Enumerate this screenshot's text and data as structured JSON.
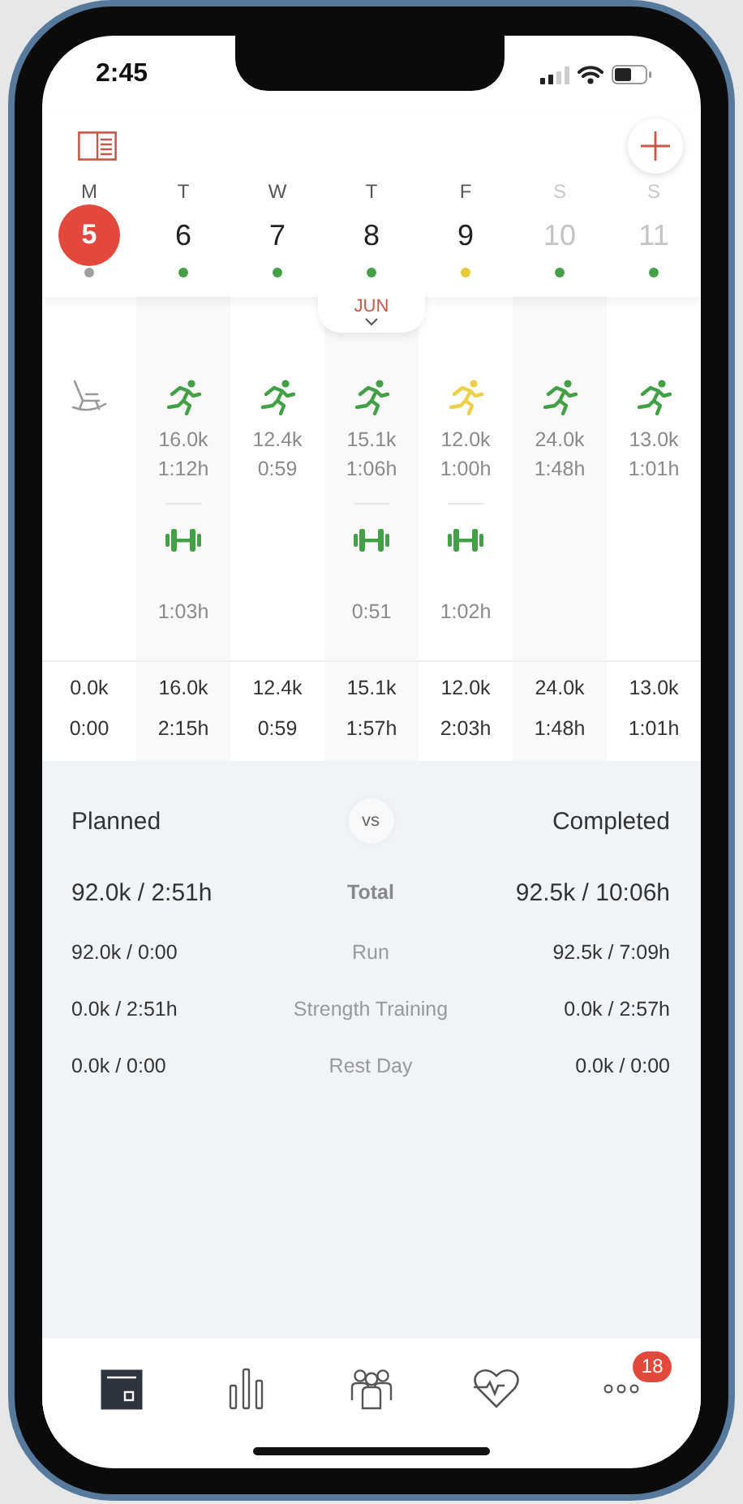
{
  "status_bar": {
    "time": "2:45"
  },
  "week": {
    "month": "JUN",
    "days": [
      {
        "weekday": "M",
        "date": "5",
        "selected": true,
        "muted": false,
        "color": "#a0a0a0",
        "activities": [
          {
            "kind": "rest"
          }
        ],
        "total_distance": "0.0k",
        "total_time": "0:00"
      },
      {
        "weekday": "T",
        "date": "6",
        "selected": false,
        "muted": false,
        "color": "#43a047",
        "activities": [
          {
            "kind": "run",
            "color": "#43a047",
            "distance": "16.0k",
            "duration": "1:12h"
          },
          {
            "kind": "strength",
            "color": "#43a047",
            "duration": "1:03h"
          }
        ],
        "total_distance": "16.0k",
        "total_time": "2:15h"
      },
      {
        "weekday": "W",
        "date": "7",
        "selected": false,
        "muted": false,
        "color": "#43a047",
        "activities": [
          {
            "kind": "run",
            "color": "#43a047",
            "distance": "12.4k",
            "duration": "0:59"
          }
        ],
        "total_distance": "12.4k",
        "total_time": "0:59"
      },
      {
        "weekday": "T",
        "date": "8",
        "selected": false,
        "muted": false,
        "color": "#43a047",
        "activities": [
          {
            "kind": "run",
            "color": "#43a047",
            "distance": "15.1k",
            "duration": "1:06h"
          },
          {
            "kind": "strength",
            "color": "#43a047",
            "duration": "0:51"
          }
        ],
        "total_distance": "15.1k",
        "total_time": "1:57h"
      },
      {
        "weekday": "F",
        "date": "9",
        "selected": false,
        "muted": false,
        "color": "#e8c93a",
        "activities": [
          {
            "kind": "run",
            "color": "#ecd04a",
            "distance": "12.0k",
            "duration": "1:00h"
          },
          {
            "kind": "strength",
            "color": "#43a047",
            "duration": "1:02h"
          }
        ],
        "total_distance": "12.0k",
        "total_time": "2:03h"
      },
      {
        "weekday": "S",
        "date": "10",
        "selected": false,
        "muted": true,
        "color": "#43a047",
        "activities": [
          {
            "kind": "run",
            "color": "#43a047",
            "distance": "24.0k",
            "duration": "1:48h"
          }
        ],
        "total_distance": "24.0k",
        "total_time": "1:48h"
      },
      {
        "weekday": "S",
        "date": "11",
        "selected": false,
        "muted": true,
        "color": "#43a047",
        "activities": [
          {
            "kind": "run",
            "color": "#43a047",
            "distance": "13.0k",
            "duration": "1:01h"
          }
        ],
        "total_distance": "13.0k",
        "total_time": "1:01h"
      }
    ]
  },
  "summary": {
    "planned_label": "Planned",
    "vs": "vs",
    "completed_label": "Completed",
    "rows": [
      {
        "kind": "total",
        "label": "Total",
        "planned": "92.0k / 2:51h",
        "completed": "92.5k / 10:06h"
      },
      {
        "kind": "item",
        "label": "Run",
        "planned": "92.0k / 0:00",
        "completed": "92.5k / 7:09h"
      },
      {
        "kind": "item",
        "label": "Strength Training",
        "planned": "0.0k / 2:51h",
        "completed": "0.0k / 2:57h"
      },
      {
        "kind": "item",
        "label": "Rest Day",
        "planned": "0.0k / 0:00",
        "completed": "0.0k / 0:00"
      }
    ]
  },
  "tab_bar": [
    {
      "kind": "calendar",
      "selected": true
    },
    {
      "kind": "stats",
      "selected": false
    },
    {
      "kind": "groups",
      "selected": false
    },
    {
      "kind": "health",
      "selected": false
    },
    {
      "kind": "more",
      "selected": false,
      "badge": "18"
    }
  ]
}
